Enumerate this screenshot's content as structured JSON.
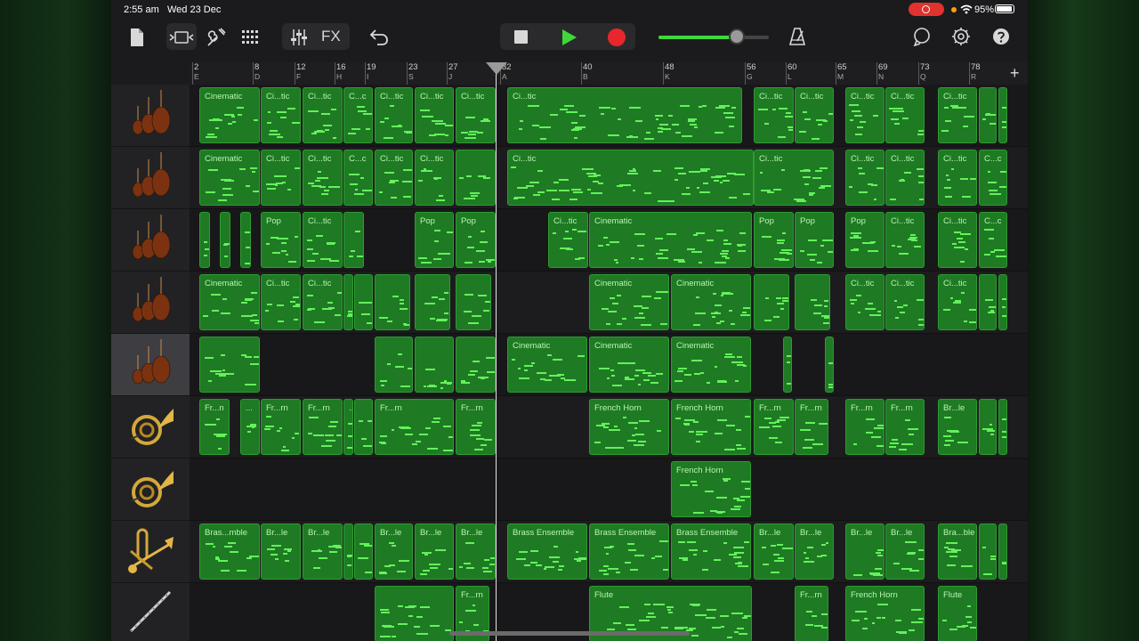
{
  "status": {
    "time": "2:55 am",
    "date": "Wed 23 Dec",
    "battery": "95%"
  },
  "toolbar": {
    "fx_label": "FX"
  },
  "icons": [
    "document-icon",
    "view-toggle-icon",
    "instrument-icon",
    "grid-icon",
    "mixer-icon",
    "fx-icon",
    "undo-icon",
    "stop-icon",
    "play-icon",
    "record-icon",
    "metronome-icon",
    "loop-icon",
    "settings-icon",
    "help-icon"
  ],
  "ruler": {
    "marks": [
      {
        "n": "2",
        "l": "E"
      },
      {
        "n": "8",
        "l": "D"
      },
      {
        "n": "12",
        "l": "F"
      },
      {
        "n": "16",
        "l": "H"
      },
      {
        "n": "19",
        "l": "I"
      },
      {
        "n": "23",
        "l": "S"
      },
      {
        "n": "27",
        "l": "J"
      },
      {
        "n": "32",
        "l": "A"
      },
      {
        "n": "40",
        "l": "B"
      },
      {
        "n": "48",
        "l": "K"
      },
      {
        "n": "56",
        "l": "G"
      },
      {
        "n": "60",
        "l": "L"
      },
      {
        "n": "65",
        "l": "M"
      },
      {
        "n": "69",
        "l": "N"
      },
      {
        "n": "73",
        "l": "Q"
      },
      {
        "n": "78",
        "l": "R"
      }
    ],
    "add_label": "+"
  },
  "tracks": [
    {
      "instrument": "strings",
      "regions": [
        [
          "Cinematic",
          0,
          68
        ],
        [
          "Ci...tic",
          69,
          45
        ],
        [
          "Ci...tic",
          116,
          45
        ],
        [
          "C...c",
          162,
          33
        ],
        [
          "Ci...tic",
          197,
          43
        ],
        [
          "Ci...tic",
          242,
          44
        ],
        [
          "Ci...tic",
          288,
          45
        ],
        [
          "Ci...tic",
          346,
          264
        ],
        [
          "Ci...tic",
          623,
          45
        ],
        [
          "Ci...tic",
          669,
          44
        ],
        [
          "Ci...tic",
          726,
          44
        ],
        [
          "Ci...tic",
          771,
          44
        ],
        [
          "Ci...tic",
          830,
          44
        ],
        [
          "",
          876,
          20
        ],
        [
          "",
          898,
          10
        ]
      ]
    },
    {
      "instrument": "strings",
      "regions": [
        [
          "Cinematic",
          0,
          68
        ],
        [
          "Ci...tic",
          69,
          45
        ],
        [
          "Ci...tic",
          116,
          45
        ],
        [
          "C...c",
          162,
          33
        ],
        [
          "Ci...tic",
          197,
          43
        ],
        [
          "Ci...tic",
          242,
          44
        ],
        [
          "",
          288,
          45
        ],
        [
          "Ci...tic",
          346,
          277
        ],
        [
          "Ci...tic",
          623,
          90
        ],
        [
          "Ci...tic",
          726,
          44
        ],
        [
          "Ci...tic",
          771,
          44
        ],
        [
          "Ci...tic",
          830,
          44
        ],
        [
          "C...c",
          876,
          32
        ]
      ]
    },
    {
      "instrument": "strings",
      "regions": [
        [
          "",
          0,
          12
        ],
        [
          "",
          23,
          12
        ],
        [
          "",
          46,
          12
        ],
        [
          "Pop",
          69,
          45
        ],
        [
          "Ci...tic",
          116,
          45
        ],
        [
          "",
          162,
          23
        ],
        [
          "Pop",
          242,
          44
        ],
        [
          "Pop",
          288,
          45
        ],
        [
          "Ci...tic",
          392,
          45
        ],
        [
          "Cinematic",
          438,
          183
        ],
        [
          "Pop",
          623,
          45
        ],
        [
          "Pop",
          669,
          44
        ],
        [
          "Pop",
          726,
          44
        ],
        [
          "Ci...tic",
          771,
          44
        ],
        [
          "Ci...tic",
          830,
          44
        ],
        [
          "C...c",
          876,
          32
        ]
      ]
    },
    {
      "instrument": "strings",
      "regions": [
        [
          "Cinematic",
          0,
          68
        ],
        [
          "Ci...tic",
          69,
          45
        ],
        [
          "Ci...tic",
          116,
          45
        ],
        [
          "",
          162,
          11
        ],
        [
          "",
          174,
          21
        ],
        [
          "",
          197,
          40
        ],
        [
          "",
          242,
          40
        ],
        [
          "",
          288,
          40
        ],
        [
          "Cinematic",
          438,
          90
        ],
        [
          "Cinematic",
          530,
          90
        ],
        [
          "",
          623,
          40
        ],
        [
          "",
          669,
          40
        ],
        [
          "Ci...tic",
          726,
          44
        ],
        [
          "Ci...tic",
          771,
          44
        ],
        [
          "Ci...tic",
          830,
          44
        ],
        [
          "",
          876,
          20
        ],
        [
          "",
          898,
          10
        ]
      ]
    },
    {
      "instrument": "strings",
      "selected": true,
      "regions": [
        [
          "",
          0,
          68
        ],
        [
          "",
          197,
          43
        ],
        [
          "",
          242,
          44
        ],
        [
          "",
          288,
          45
        ],
        [
          "Cinematic",
          346,
          90
        ],
        [
          "Cinematic",
          438,
          90
        ],
        [
          "Cinematic",
          530,
          90
        ],
        [
          "",
          656,
          10
        ],
        [
          "",
          703,
          10
        ]
      ]
    },
    {
      "instrument": "french-horn",
      "regions": [
        [
          "Fr...n",
          0,
          34
        ],
        [
          "...",
          46,
          22
        ],
        [
          "Fr...rn",
          69,
          45
        ],
        [
          "Fr...rn",
          116,
          45
        ],
        [
          "...",
          162,
          11
        ],
        [
          "",
          174,
          21
        ],
        [
          "Fr...rn",
          197,
          89
        ],
        [
          "Fr...rn",
          288,
          45
        ],
        [
          "French Horn",
          438,
          90
        ],
        [
          "French Horn",
          530,
          90
        ],
        [
          "Fr...rn",
          623,
          45
        ],
        [
          "Fr...rn",
          669,
          38
        ],
        [
          "Fr...rn",
          726,
          44
        ],
        [
          "Fr...rn",
          771,
          44
        ],
        [
          "Br...le",
          830,
          44
        ],
        [
          "",
          876,
          20
        ],
        [
          "",
          898,
          10
        ]
      ]
    },
    {
      "instrument": "french-horn",
      "regions": [
        [
          "French Horn",
          530,
          90
        ]
      ]
    },
    {
      "instrument": "brass",
      "regions": [
        [
          "Bras...mble",
          0,
          68
        ],
        [
          "Br...le",
          69,
          45
        ],
        [
          "Br...le",
          116,
          45
        ],
        [
          "",
          162,
          11
        ],
        [
          "",
          174,
          21
        ],
        [
          "Br...le",
          197,
          43
        ],
        [
          "Br...le",
          242,
          44
        ],
        [
          "Br...le",
          288,
          45
        ],
        [
          "Brass Ensemble",
          346,
          90
        ],
        [
          "Brass Ensemble",
          438,
          90
        ],
        [
          "Brass Ensemble",
          530,
          90
        ],
        [
          "Br...le",
          623,
          45
        ],
        [
          "Br...le",
          669,
          44
        ],
        [
          "Br...le",
          726,
          44
        ],
        [
          "Br...le",
          771,
          44
        ],
        [
          "Bra...ble",
          830,
          44
        ],
        [
          "",
          876,
          20
        ],
        [
          "",
          898,
          10
        ]
      ]
    },
    {
      "instrument": "flute",
      "regions": [
        [
          "",
          197,
          89
        ],
        [
          "Fr...rn",
          288,
          38
        ],
        [
          "Flute",
          438,
          183
        ],
        [
          "Fr...rn",
          669,
          38
        ],
        [
          "French Horn",
          726,
          89
        ],
        [
          "Flute",
          830,
          44
        ]
      ]
    }
  ]
}
